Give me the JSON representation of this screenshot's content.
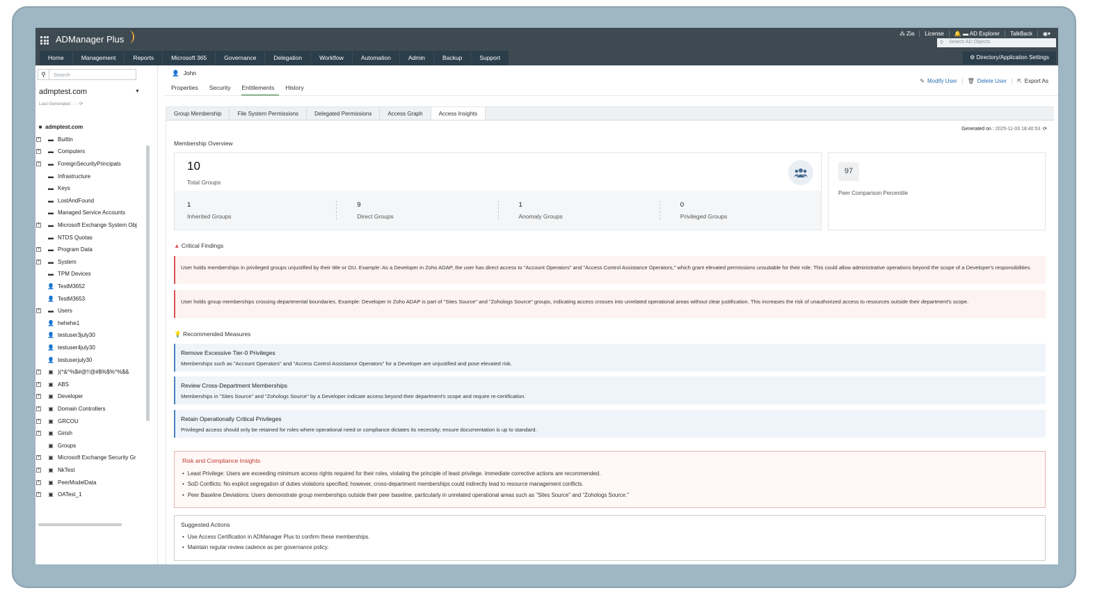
{
  "app": {
    "brand": "ADManager Plus",
    "topright": {
      "zia": "Zia",
      "license": "License",
      "ad_explorer": "AD Explorer",
      "talkback": "TalkBack"
    },
    "search_placeholder": "Search AD Objects",
    "nav": [
      "Home",
      "Management",
      "Reports",
      "Microsoft 365",
      "Governance",
      "Delegation",
      "Workflow",
      "Automation",
      "Admin",
      "Backup",
      "Support"
    ],
    "dir_settings": "Directory/Application Settings"
  },
  "left": {
    "search_placeholder": "Search",
    "domain": "admptest.com",
    "last_generated": "Last Generated : : -",
    "tree": [
      {
        "label": "admptest.com",
        "icon": "domain",
        "root": true
      },
      {
        "label": "Builtin",
        "icon": "folder",
        "exp": true
      },
      {
        "label": "Computers",
        "icon": "folder",
        "exp": true
      },
      {
        "label": "ForeignSecurityPrincipals",
        "icon": "folder",
        "exp": true
      },
      {
        "label": "Infrastructure",
        "icon": "folder",
        "exp": false
      },
      {
        "label": "Keys",
        "icon": "folder",
        "exp": false
      },
      {
        "label": "LostAndFound",
        "icon": "folder",
        "exp": false
      },
      {
        "label": "Managed Service Accounts",
        "icon": "folder",
        "exp": false
      },
      {
        "label": "Microsoft Exchange System Obj",
        "icon": "folder",
        "exp": true
      },
      {
        "label": "NTDS Quotas",
        "icon": "folder",
        "exp": false
      },
      {
        "label": "Program Data",
        "icon": "folder",
        "exp": true
      },
      {
        "label": "System",
        "icon": "folder",
        "exp": true
      },
      {
        "label": "TPM Devices",
        "icon": "folder",
        "exp": false
      },
      {
        "label": "TestM3652",
        "icon": "user",
        "exp": false
      },
      {
        "label": "TestM3653",
        "icon": "user",
        "exp": false
      },
      {
        "label": "Users",
        "icon": "folder",
        "exp": true
      },
      {
        "label": "hehehe1",
        "icon": "user",
        "exp": false
      },
      {
        "label": "testuser3july30",
        "icon": "user",
        "exp": false
      },
      {
        "label": "testuser4july30",
        "icon": "user",
        "exp": false
      },
      {
        "label": "testuserjuly30",
        "icon": "user",
        "exp": false
      },
      {
        "label": ")(*&^%$#@!!@#$%$%^%$&",
        "icon": "ou",
        "exp": true
      },
      {
        "label": "ABS",
        "icon": "ou",
        "exp": true
      },
      {
        "label": "Developer",
        "icon": "ou",
        "exp": true
      },
      {
        "label": "Domain Controllers",
        "icon": "ou",
        "exp": true
      },
      {
        "label": "GRCOU",
        "icon": "ou",
        "exp": true
      },
      {
        "label": "Girish",
        "icon": "ou",
        "exp": true
      },
      {
        "label": "Groups",
        "icon": "ou",
        "exp": false
      },
      {
        "label": "Microsoft Exchange Security Gr",
        "icon": "ou",
        "exp": true
      },
      {
        "label": "NkTest",
        "icon": "ou",
        "exp": true
      },
      {
        "label": "PeerModelData",
        "icon": "ou",
        "exp": true
      },
      {
        "label": "OATest_1",
        "icon": "ou",
        "exp": true
      }
    ]
  },
  "main": {
    "user": "John",
    "subtabs": [
      "Properties",
      "Security",
      "Entitlements",
      "History"
    ],
    "active_subtab": "Entitlements",
    "actions": {
      "modify": "Modify User",
      "delete": "Delete User",
      "export": "Export As"
    },
    "ent_tabs": [
      "Group Membership",
      "File System Permissions",
      "Delegated Permissions",
      "Access Graph",
      "Access Insights"
    ],
    "active_ent_tab": "Access Insights",
    "generated_label": "Generated on :",
    "generated_value": "2025-11-03 18:40:53",
    "overview": {
      "title": "Membership Overview",
      "total": "10",
      "total_label": "Total Groups",
      "cells": [
        {
          "n": "1",
          "l": "Inherited Groups"
        },
        {
          "n": "9",
          "l": "Direct Groups"
        },
        {
          "n": "1",
          "l": "Anomaly Groups"
        },
        {
          "n": "0",
          "l": "Privileged Groups"
        }
      ],
      "peer_value": "97",
      "peer_label": "Peer Comparison Percentile"
    },
    "critical": {
      "title": "Critical Findings",
      "items": [
        "User holds memberships in privileged groups unjustified by their title or OU. Example: As a Developer in Zoho ADAP, the user has direct access to \"Account Operators\" and \"Access Control Assistance Operators,\" which grant elevated permissions unsuitable for their role. This could allow administrative operations beyond the scope of a Developer's responsibilities.",
        "User holds group memberships crossing departmental boundaries. Example: Developer in Zoho ADAP is part of \"Sites Source\" and \"Zohologs Source\" groups, indicating access crosses into unrelated operational areas without clear justification. This increases the risk of unauthorized access to resources outside their department's scope."
      ]
    },
    "recommended": {
      "title": "Recommended Measures",
      "items": [
        {
          "t": "Remove Excessive Tier-0 Privileges",
          "d": "Memberships such as \"Account Operators\" and \"Access Control Assistance Operators\" for a Developer are unjustified and pose elevated risk."
        },
        {
          "t": "Review Cross-Department Memberships",
          "d": "Memberships in \"Sites Source\" and \"Zohologs Source\" by a Developer indicate access beyond their department's scope and require re-certification."
        },
        {
          "t": "Retain Operationally Critical Privileges",
          "d": "Privileged access should only be retained for roles where operational need or compliance dictates its necessity; ensure documentation is up to standard."
        }
      ]
    },
    "risk": {
      "title": "Risk and Compliance Insights",
      "items": [
        "Least Privilege: Users are exceeding minimum access rights required for their roles, violating the principle of least privilege. Immediate corrective actions are recommended.",
        "SoD Conflicts: No explicit segregation of duties violations specified; however, cross-department memberships could indirectly lead to resource management conflicts.",
        "Peer Baseline Deviations: Users demonstrate group memberships outside their peer baseline, particularly in unrelated operational areas such as \"Sites Source\" and \"Zohologs Source.\""
      ]
    },
    "suggested": {
      "title": "Suggested Actions",
      "items": [
        "Use Access Certification in ADManager Plus to confirm these memberships.",
        "Maintain regular review cadence as per governance policy."
      ]
    }
  }
}
